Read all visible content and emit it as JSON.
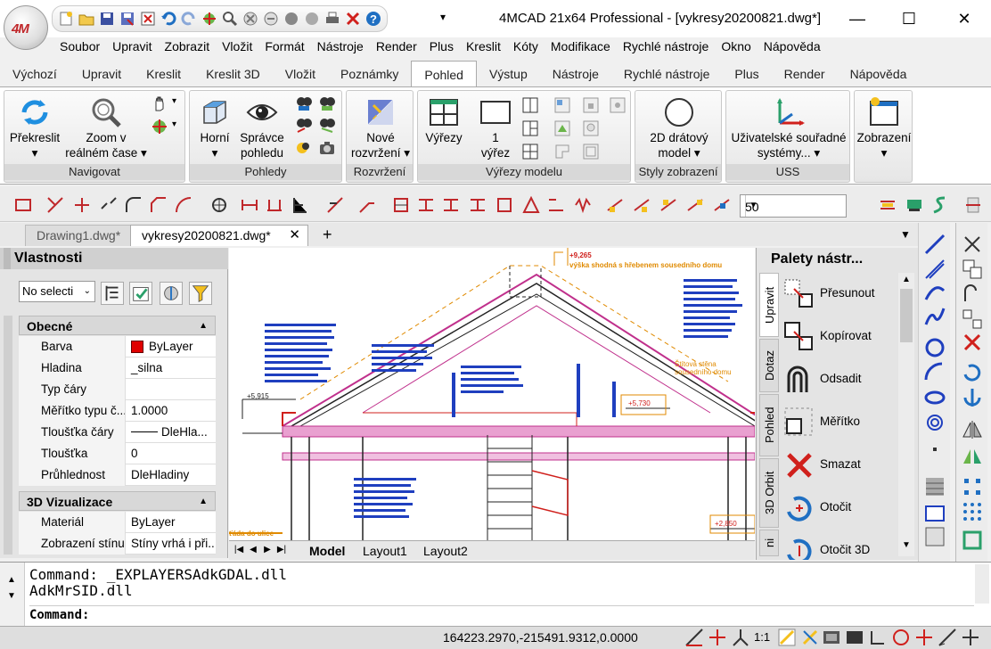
{
  "window": {
    "title": "4MCAD 21x64 Professional - [vykresy20200821.dwg*]",
    "logo_text": "4M"
  },
  "menubar": [
    "Soubor",
    "Upravit",
    "Zobrazit",
    "Vložit",
    "Formát",
    "Nástroje",
    "Render",
    "Plus",
    "Kreslit",
    "Kóty",
    "Modifikace",
    "Rychlé nástroje",
    "Okno",
    "Nápověda"
  ],
  "ribbon_tabs": [
    "Výchozí",
    "Upravit",
    "Kreslit",
    "Kreslit 3D",
    "Vložit",
    "Poznámky",
    "Pohled",
    "Výstup",
    "Nástroje",
    "Rychlé nástroje",
    "Plus",
    "Render",
    "Nápověda"
  ],
  "ribbon_active_tab": "Pohled",
  "ribbon": {
    "navigovat": {
      "title": "Navigovat",
      "prekreslit": "Překreslit",
      "zoom": "Zoom v",
      "zoom2": "reálném čase"
    },
    "pohledy": {
      "title": "Pohledy",
      "horni": "Horní",
      "spravce": "Správce",
      "spravce2": "pohledu"
    },
    "rozvrzeni": {
      "title": "Rozvržení",
      "nove": "Nové",
      "nove2": "rozvržení"
    },
    "vyrezy": {
      "title": "Výřezy modelu",
      "vyrezy": "Výřezy",
      "one": "1",
      "one2": "výřez"
    },
    "styly": {
      "title": "Styly zobrazení",
      "drat": "2D drátový",
      "drat2": "model"
    },
    "uss": {
      "title": "USS",
      "uziv": "Uživatelské souřadné",
      "uziv2": "systémy..."
    },
    "zobrazeni": {
      "label": "Zobrazení"
    }
  },
  "toolbar2": {
    "scale_value": "50"
  },
  "doc_tabs": {
    "tab1": "Drawing1.dwg*",
    "tab2": "vykresy20200821.dwg*",
    "add": "+"
  },
  "properties": {
    "title": "Vlastnosti",
    "selection": "No selecti",
    "section_general": "Obecné",
    "rows_general": [
      {
        "k": "Barva",
        "v": "ByLayer"
      },
      {
        "k": "Hladina",
        "v": "_silna"
      },
      {
        "k": "Typ čáry",
        "v": ""
      },
      {
        "k": "Měřítko typu č...",
        "v": "1.0000"
      },
      {
        "k": "Tloušťka čáry",
        "v": "DleHla..."
      },
      {
        "k": "Tloušťka",
        "v": "0"
      },
      {
        "k": "Průhlednost",
        "v": "DleHladiny"
      }
    ],
    "section_3d": "3D Vizualizace",
    "rows_3d": [
      {
        "k": "Materiál",
        "v": "ByLayer"
      },
      {
        "k": "Zobrazení stínu",
        "v": "Stíny vrhá i při..."
      }
    ]
  },
  "layout_tabs": {
    "model": "Model",
    "layout1": "Layout1",
    "layout2": "Layout2"
  },
  "drawing_annotations": {
    "a1": "+9,265",
    "a2": "výška shodná s hřebenem sousedního domu",
    "a3": "+5,915",
    "a4": "+5,730",
    "a5": "+2,850",
    "a6": "Štítová stěna sousedního domu",
    "a7": "ťáda do ulice"
  },
  "tool_palettes": {
    "title": "Palety nástr...",
    "vtabs": [
      "Upravit",
      "Dotaz",
      "Pohled",
      "3D Orbit",
      "ni"
    ],
    "items": [
      "Přesunout",
      "Kopírovat",
      "Odsadit",
      "Měřítko",
      "Smazat",
      "Otočit",
      "Otočit 3D"
    ]
  },
  "command": {
    "line1": "Command: _EXPLAYERSAdkGDAL.dll",
    "line2": "AdkMrSID.dll",
    "prompt": "Command:"
  },
  "status": {
    "coords": "164223.2970,-215491.9312,0.0000",
    "scale": "1:1"
  },
  "colors": {
    "accent_red": "#d0201c",
    "accent_blue": "#1f6fc2",
    "drawing_magenta": "#c0308c",
    "drawing_orange": "#e08a00"
  }
}
